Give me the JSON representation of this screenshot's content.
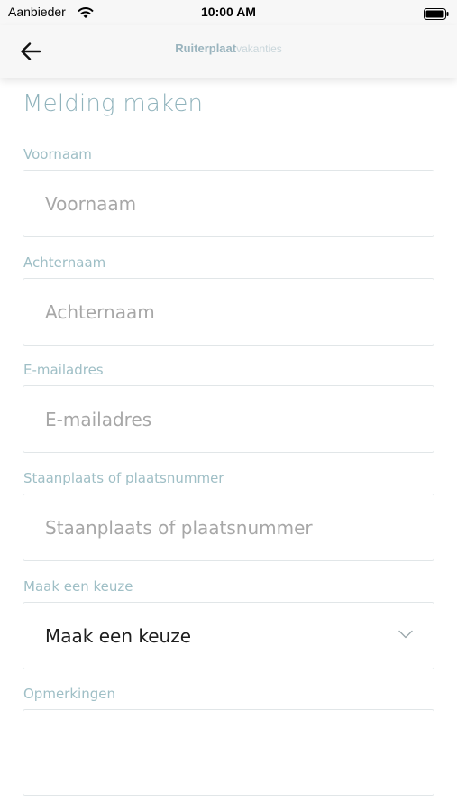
{
  "status_bar": {
    "carrier": "Aanbieder",
    "time": "10:00 AM"
  },
  "nav": {
    "brand_main": "Ruiterplaat",
    "brand_sub": "vakanties"
  },
  "page": {
    "title": "Melding maken"
  },
  "form": {
    "first_name": {
      "label": "Voornaam",
      "placeholder": "Voornaam",
      "value": ""
    },
    "last_name": {
      "label": "Achternaam",
      "placeholder": "Achternaam",
      "value": ""
    },
    "email": {
      "label": "E-mailadres",
      "placeholder": "E-mailadres",
      "value": ""
    },
    "pitch": {
      "label": "Staanplaats of plaatsnummer",
      "placeholder": "Staanplaats of plaatsnummer",
      "value": ""
    },
    "choice": {
      "label": "Maak een keuze",
      "selected": "Maak een keuze"
    },
    "remarks": {
      "label": "Opmerkingen",
      "value": ""
    }
  },
  "icons": [
    "wifi-icon",
    "battery-icon",
    "back-arrow-icon",
    "chevron-down-icon"
  ],
  "colors": {
    "accent": "#90b3bc",
    "label": "#9fbfc6",
    "border": "#e1e6e8",
    "nav_bg": "#f7f7f7"
  }
}
